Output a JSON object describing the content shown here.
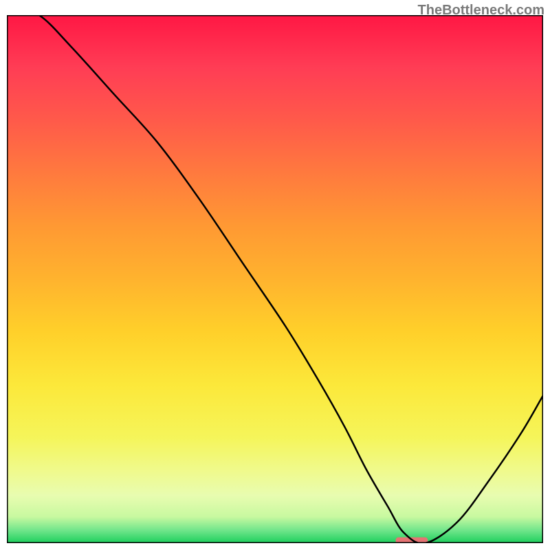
{
  "watermark": "TheBottleneck.com",
  "chart_data": {
    "type": "line",
    "title": "",
    "xlabel": "",
    "ylabel": "",
    "xlim": [
      0,
      100
    ],
    "ylim": [
      0,
      100
    ],
    "x": [
      0,
      6,
      12,
      20,
      28,
      36,
      44,
      52,
      58,
      63,
      67,
      71,
      74,
      78,
      84,
      90,
      96,
      100
    ],
    "values": [
      102,
      100,
      94,
      85,
      76,
      65,
      53,
      41,
      31,
      22,
      14,
      7,
      2,
      0,
      4,
      12,
      21,
      28
    ],
    "marker": {
      "x": 75.5,
      "y": 0.5,
      "width": 6,
      "height": 1.2,
      "color": "#e57373"
    },
    "gradient_stops": [
      {
        "offset": 0.0,
        "color": "#ff1744"
      },
      {
        "offset": 0.1,
        "color": "#ff3d55"
      },
      {
        "offset": 0.2,
        "color": "#ff5a4a"
      },
      {
        "offset": 0.3,
        "color": "#ff7a3e"
      },
      {
        "offset": 0.4,
        "color": "#ff9933"
      },
      {
        "offset": 0.5,
        "color": "#ffb32e"
      },
      {
        "offset": 0.6,
        "color": "#ffd02a"
      },
      {
        "offset": 0.7,
        "color": "#fce83a"
      },
      {
        "offset": 0.8,
        "color": "#f5f55a"
      },
      {
        "offset": 0.86,
        "color": "#f0fa8a"
      },
      {
        "offset": 0.91,
        "color": "#e8fcb0"
      },
      {
        "offset": 0.95,
        "color": "#c8f9a0"
      },
      {
        "offset": 0.975,
        "color": "#73e68c"
      },
      {
        "offset": 1.0,
        "color": "#1ccf5c"
      }
    ],
    "grid": false,
    "legend": null
  }
}
